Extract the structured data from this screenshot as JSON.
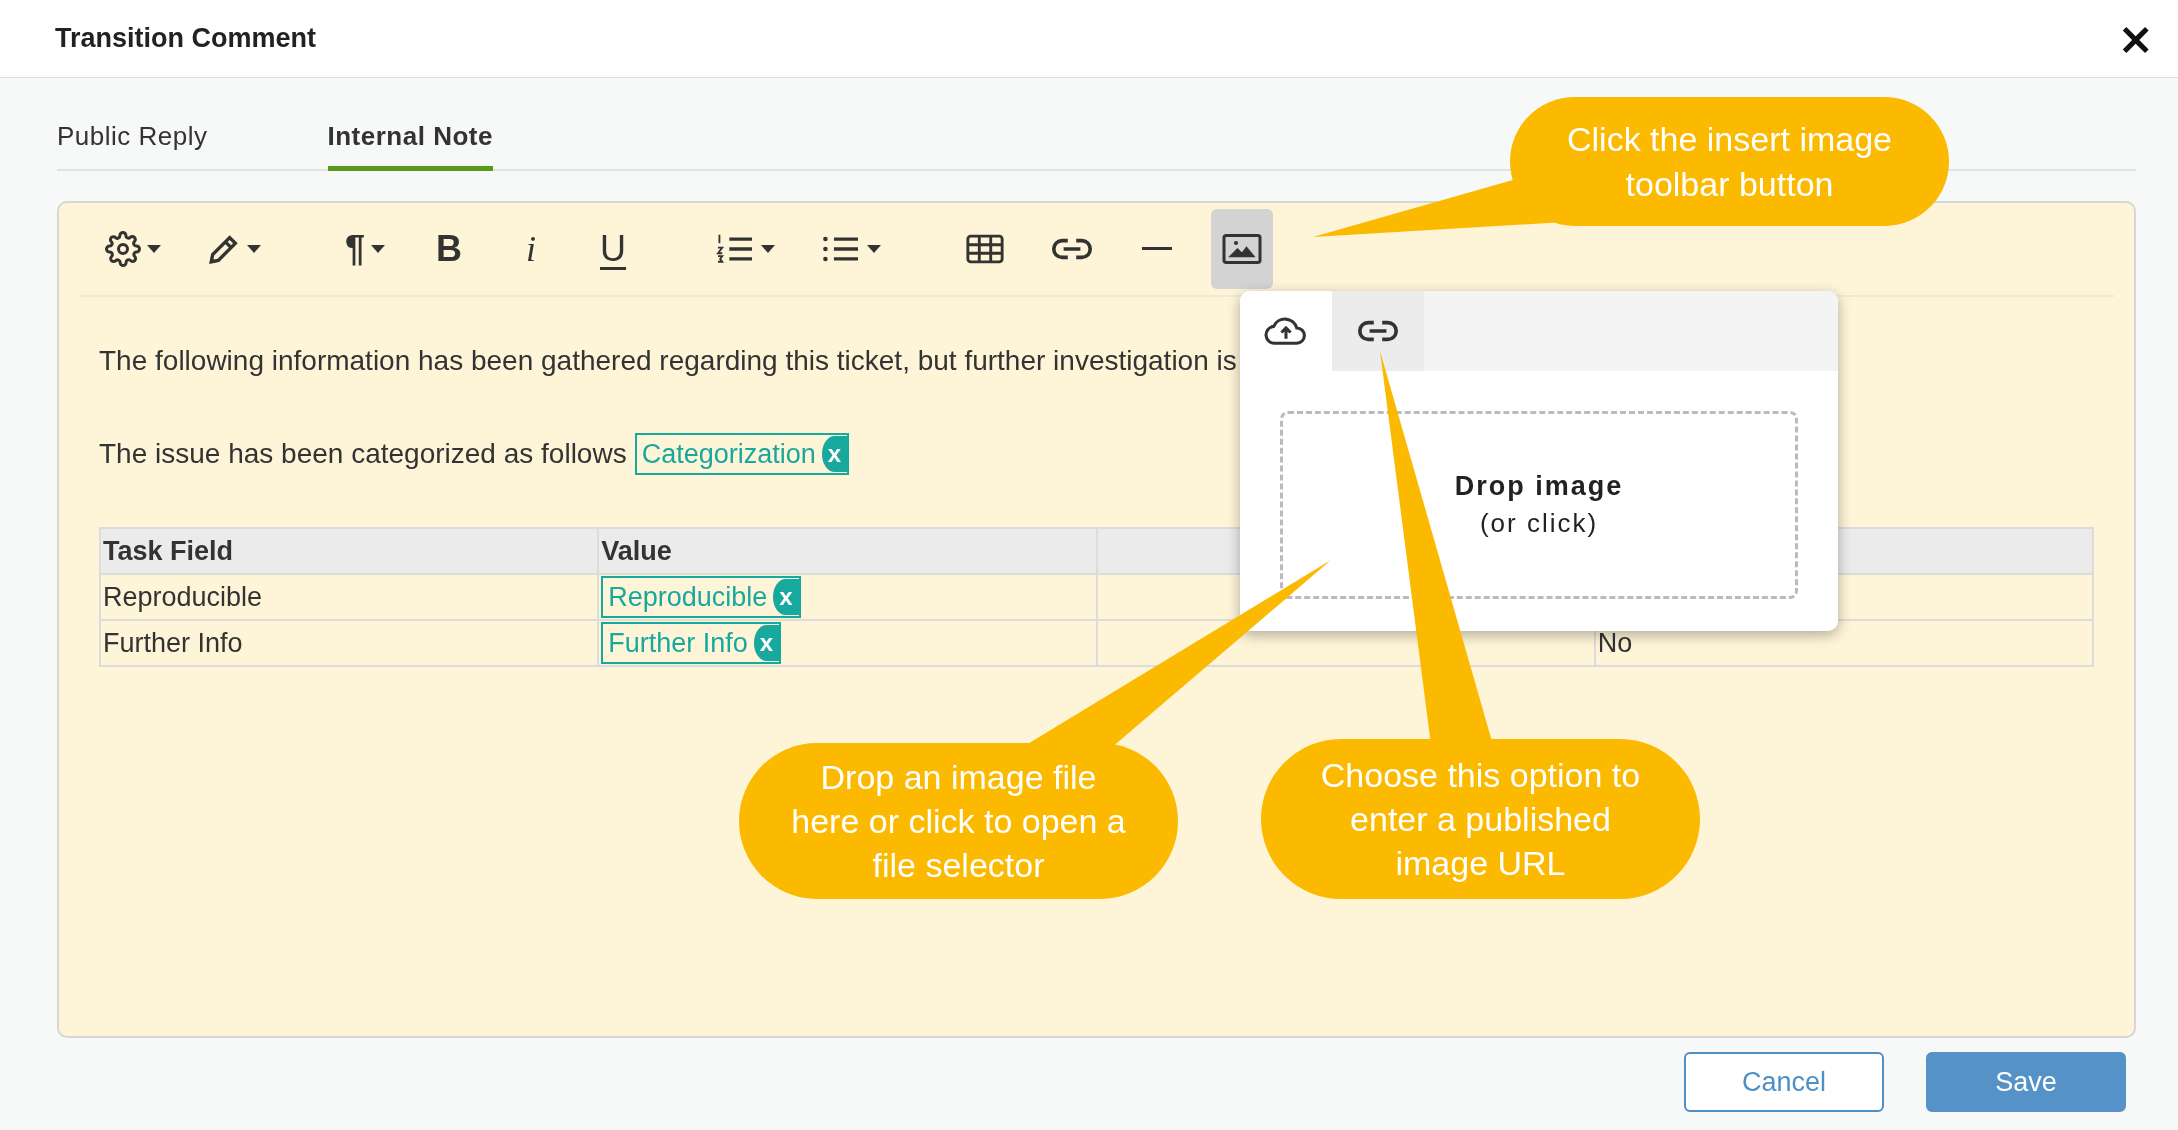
{
  "window": {
    "title": "Transition Comment",
    "close": "×"
  },
  "tabs": [
    {
      "label": "Public Reply",
      "selected": false
    },
    {
      "label": "Internal Note",
      "selected": true
    }
  ],
  "toolbar": {
    "groups": [
      [
        {
          "kind": "gear",
          "caret": true,
          "active": false
        },
        {
          "kind": "pencil",
          "caret": true,
          "active": false
        }
      ],
      [
        {
          "kind": "paragraph",
          "label": "¶",
          "caret": true,
          "active": false
        },
        {
          "kind": "bold",
          "label": "B",
          "caret": false,
          "active": false
        },
        {
          "kind": "italic",
          "label": "i",
          "caret": false,
          "active": false
        },
        {
          "kind": "underline",
          "label": "U",
          "caret": false,
          "active": false
        }
      ],
      [
        {
          "kind": "ordered-list",
          "caret": true,
          "active": false
        },
        {
          "kind": "bullet-list",
          "caret": true,
          "active": false
        }
      ],
      [
        {
          "kind": "table",
          "caret": false,
          "active": false
        },
        {
          "kind": "link",
          "caret": false,
          "active": false
        },
        {
          "kind": "rule",
          "caret": false,
          "active": false
        },
        {
          "kind": "image",
          "caret": false,
          "active": true
        }
      ]
    ]
  },
  "editor": {
    "paragraphs": [
      {
        "text": "The following information has been gathered regarding this ticket, but further investigation is"
      },
      {
        "text": "The issue has been categorized as follows",
        "tag": "Categorization",
        "remove": "x"
      }
    ],
    "table": {
      "columns": [
        {
          "label": "Task Field"
        },
        {
          "label": "Value"
        },
        {},
        {}
      ],
      "rows": [
        [
          {
            "text": "Reproducible"
          },
          {
            "tag": "Reproducible",
            "remove": "x"
          },
          {},
          {}
        ],
        [
          {
            "text": "Further Info"
          },
          {
            "tag": "Further Info",
            "remove": "x"
          },
          {},
          {
            "text": "No"
          }
        ]
      ]
    }
  },
  "image_popup": {
    "tabs": [
      {
        "kind": "upload",
        "selected": true
      },
      {
        "kind": "url",
        "selected": false
      }
    ],
    "dropzone": {
      "title": "Drop image",
      "hint": "(or click)"
    }
  },
  "callouts": [
    {
      "text": "Click the insert image toolbar button"
    },
    {
      "text": "Drop an image file here or click to open a file selector"
    },
    {
      "text": "Choose this option to enter a published image URL"
    }
  ],
  "buttons": [
    {
      "label": "Cancel",
      "kind": "secondary"
    },
    {
      "label": "Save",
      "kind": "primary"
    }
  ]
}
